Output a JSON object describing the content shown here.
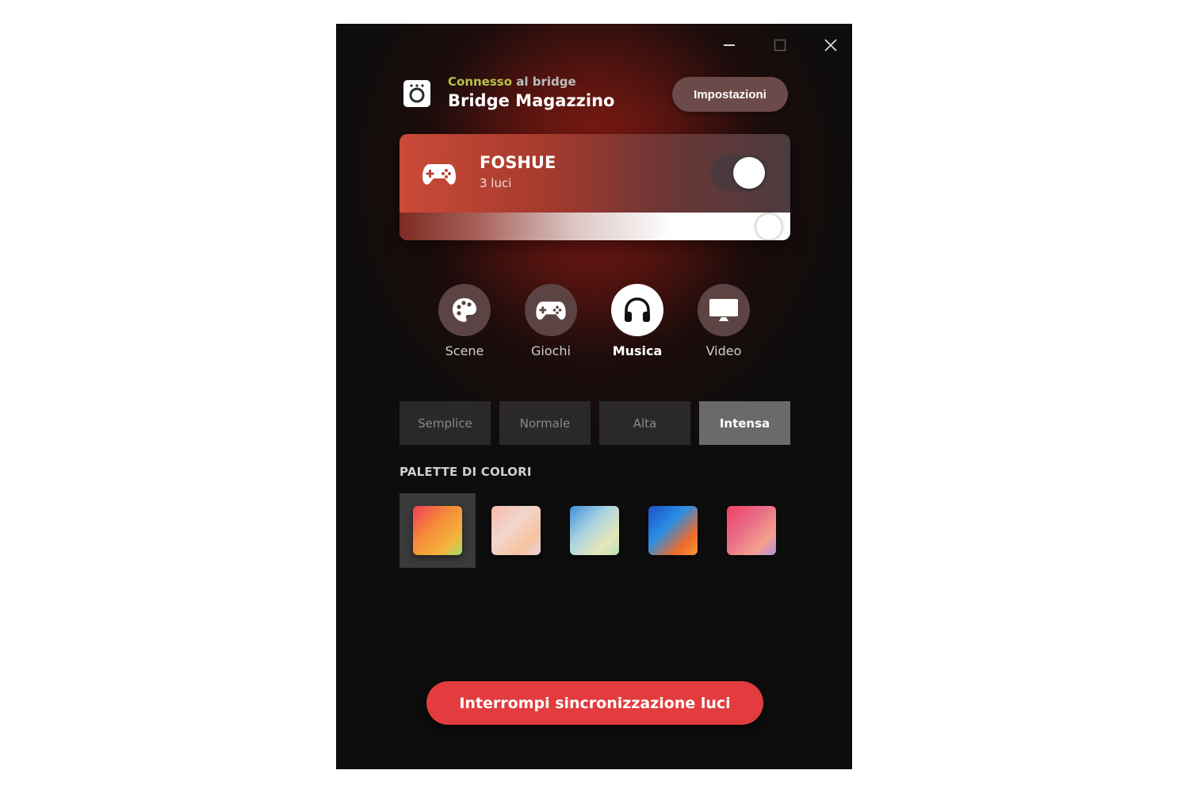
{
  "window": {
    "controls": [
      "minimize",
      "maximize",
      "close"
    ]
  },
  "header": {
    "status_ok": "Connesso",
    "status_rest": " al bridge",
    "status_color": "#b7c24c",
    "bridge_name": "Bridge Magazzino",
    "settings_label": "Impostazioni",
    "bridge_icon": "bridge-icon"
  },
  "area": {
    "name": "FOSHUE",
    "lights": "3 luci",
    "icon": "gamepad-icon",
    "sync_on": true,
    "brightness_fraction": 0.98,
    "card_color": "#cb4a38"
  },
  "modes": [
    {
      "label": "Scene",
      "icon": "palette-icon",
      "active": false
    },
    {
      "label": "Giochi",
      "icon": "gamepad-icon",
      "active": false
    },
    {
      "label": "Musica",
      "icon": "headphones-icon",
      "active": true
    },
    {
      "label": "Video",
      "icon": "monitor-icon",
      "active": false
    }
  ],
  "intensity": [
    {
      "label": "Semplice",
      "active": false
    },
    {
      "label": "Normale",
      "active": false
    },
    {
      "label": "Alta",
      "active": false
    },
    {
      "label": "Intensa",
      "active": true
    }
  ],
  "palette": {
    "title": "PALETTE DI COLORI",
    "swatches": [
      {
        "colors": [
          "#ee3c5a",
          "#f58a3a",
          "#f5b33c",
          "#9fe06a"
        ],
        "active": true
      },
      {
        "colors": [
          "#f6b8a8",
          "#f2d6cc",
          "#f6c3a0",
          "#e9d0e4"
        ],
        "active": false
      },
      {
        "colors": [
          "#3f8fd9",
          "#a9d3e2",
          "#e7e6b8",
          "#b9e0b6"
        ],
        "active": false
      },
      {
        "colors": [
          "#1b4fc5",
          "#2a8fe3",
          "#f06a2a",
          "#f59a3b"
        ],
        "active": false
      },
      {
        "colors": [
          "#f23f63",
          "#e86d88",
          "#f59f8c",
          "#b48fde"
        ],
        "active": false
      }
    ]
  },
  "footer": {
    "stop_label": "Interrompi sincronizzazione luci",
    "stop_color": "#e23c3e"
  }
}
